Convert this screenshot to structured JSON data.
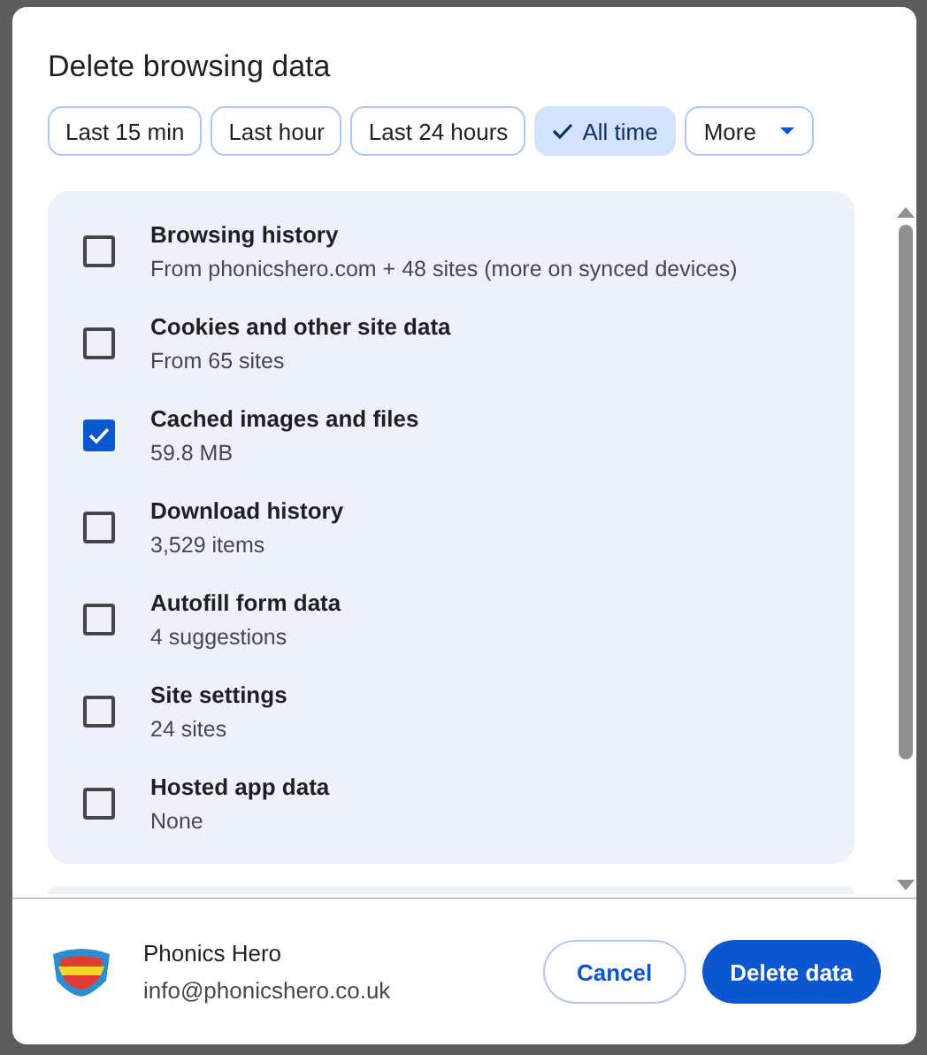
{
  "dialog": {
    "title": "Delete browsing data"
  },
  "time_ranges": [
    {
      "label": "Last 15 min",
      "selected": false
    },
    {
      "label": "Last hour",
      "selected": false
    },
    {
      "label": "Last 24 hours",
      "selected": false
    },
    {
      "label": "All time",
      "selected": true
    }
  ],
  "more_button": {
    "label": "More"
  },
  "data_types": [
    {
      "label": "Browsing history",
      "detail": "From phonicshero.com + 48 sites (more on synced devices)",
      "checked": false
    },
    {
      "label": "Cookies and other site data",
      "detail": "From 65 sites",
      "checked": false
    },
    {
      "label": "Cached images and files",
      "detail": "59.8 MB",
      "checked": true
    },
    {
      "label": "Download history",
      "detail": "3,529 items",
      "checked": false
    },
    {
      "label": "Autofill form data",
      "detail": "4 suggestions",
      "checked": false
    },
    {
      "label": "Site settings",
      "detail": "24 sites",
      "checked": false
    },
    {
      "label": "Hosted app data",
      "detail": "None",
      "checked": false
    }
  ],
  "account": {
    "name": "Phonics Hero",
    "email": "info@phonicshero.co.uk"
  },
  "buttons": {
    "cancel": "Cancel",
    "confirm": "Delete data"
  }
}
